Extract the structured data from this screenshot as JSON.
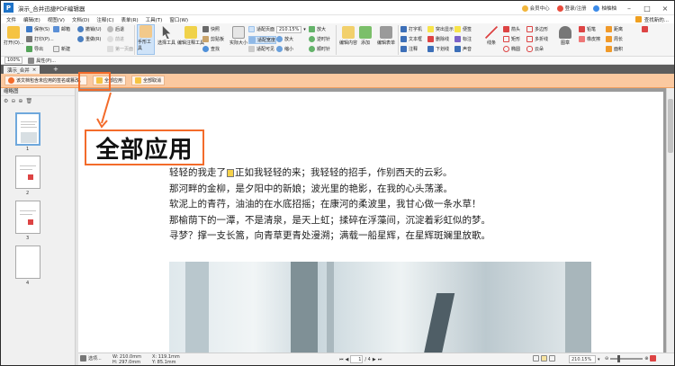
{
  "window": {
    "title": "演示_合并迅捷PDF编辑器",
    "right_items": [
      "会员中心",
      "登录/注册",
      "柚柚柚"
    ]
  },
  "menu": {
    "items": [
      "文件",
      "编辑(E)",
      "视图(V)",
      "文档(D)",
      "注释(C)",
      "表单(R)",
      "工具(T)",
      "窗口(W)"
    ],
    "right": "查找新的..."
  },
  "ribbon": {
    "open": "打开(O)...",
    "save": "保存(S)",
    "print": "打印(P)...",
    "export": "导出",
    "new": "新建",
    "mail": "邮箱",
    "undo": "撤销(U)",
    "redo": "重做(R)",
    "prev": "后退",
    "next": "前进",
    "first_page": "第一页面",
    "hand": "手形工具",
    "select": "选择工具",
    "edit_content": "编辑注释工具",
    "snapshot": "快照",
    "clipboard": "剪贴板",
    "find": "查找",
    "actual": "实际大小",
    "fit_page": "适配页面",
    "fit_width": "适配宽度",
    "fit_visible": "适配可见",
    "zoom_value": "210.15%",
    "zoom_in": "放大",
    "zoom_out": "缩小",
    "rotate_left": "逆时针",
    "rotate_right": "顺时针",
    "edit_content2": "编辑内容",
    "add": "添加",
    "edit_form": "编辑表单",
    "typewriter": "打字机",
    "textbox": "文本框",
    "annotation": "注释",
    "highlight": "突出显示",
    "underline": "下划线",
    "strike": "删除线",
    "sticky": "便签",
    "callout": "标注",
    "sound": "声音",
    "line": "线条",
    "arrow": "箭头",
    "rect": "矩形",
    "polygon": "多边形",
    "ellipse": "椭圆",
    "cloud": "云朵",
    "polyline": "多折线",
    "pencil": "铅笔",
    "eraser": "橡皮擦",
    "stamp": "图章",
    "measure": "距离",
    "perimeter": "周长",
    "area": "面积",
    "help_label": "帮助"
  },
  "quickbar": {
    "zoom": "100%",
    "props": "属性(P)..."
  },
  "doc_tab": {
    "label": "演示_合并",
    "close": "×",
    "add": "+"
  },
  "notice": {
    "message": "该文档包含未应用的签名或篡改。",
    "apply_all": "全部应用",
    "cancel_all": "全部取消"
  },
  "callout": {
    "label": "全部应用"
  },
  "left_panel": {
    "title": "缩略图",
    "pages": [
      "1",
      "2",
      "3",
      "4"
    ]
  },
  "document": {
    "poem_lines": [
      "轻轻的我走了，正如我轻轻的来；我轻轻的招手，作别西天的云彩。",
      "那河畔的金柳，是夕阳中的新娘；波光里的艳影，在我的心头荡漾。",
      "软泥上的青荇，油油的在水底招摇；在康河的柔波里，我甘心做一条水草！",
      "那榆荫下的一潭，不是清泉，是天上虹；揉碎在浮藻间，沉淀着彩虹似的梦。",
      "寻梦？撑一支长篙，向青草更青处漫溯；满载一船星辉，在星辉斑斓里放歌。"
    ],
    "poem_line1_a": "轻轻的我走了",
    "poem_line1_b": "正如我轻轻的来；我轻轻的招手，作别西天的云彩。"
  },
  "statusbar": {
    "options": "选项...",
    "width": "W: 210.0mm",
    "height": "H: 297.0mm",
    "x": "X: 119.1mm",
    "y": "Y: 85.1mm",
    "page_current": "1",
    "page_total": "/ 4",
    "zoom": "210.15%"
  },
  "colors": {
    "accent_orange": "#f36b2a",
    "notice_bg": "#fbc9a0",
    "tab_bar": "#5d5d5d"
  }
}
